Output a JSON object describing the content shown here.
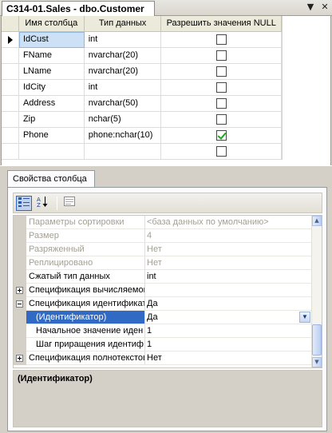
{
  "document_tab": {
    "title": "C314-01.Sales - dbo.Customer",
    "pin_icon": "▼",
    "close_icon": "✕"
  },
  "grid": {
    "headers": [
      "Имя столбца",
      "Тип данных",
      "Разрешить значения NULL"
    ],
    "rows": [
      {
        "name": "IdCust",
        "type": "int",
        "allow_null": false,
        "current": true
      },
      {
        "name": "FName",
        "type": "nvarchar(20)",
        "allow_null": false
      },
      {
        "name": "LName",
        "type": "nvarchar(20)",
        "allow_null": false
      },
      {
        "name": "IdCity",
        "type": "int",
        "allow_null": false
      },
      {
        "name": "Address",
        "type": "nvarchar(50)",
        "allow_null": false
      },
      {
        "name": "Zip",
        "type": "nchar(5)",
        "allow_null": false
      },
      {
        "name": "Phone",
        "type": "phone:nchar(10)",
        "allow_null": true
      },
      {
        "name": "",
        "type": "",
        "allow_null": false
      }
    ]
  },
  "properties": {
    "tab_label": "Свойства столбца",
    "toolbar": {
      "categorized_icon": "categorized-icon",
      "alphabetical_icon": "alphabetical-icon",
      "pages_icon": "property-pages-icon"
    },
    "rows": [
      {
        "name": "Параметры сортировки",
        "value": "<база данных по умолчанию>",
        "disabled": true
      },
      {
        "name": "Размер",
        "value": "4",
        "disabled": true
      },
      {
        "name": "Разряженный",
        "value": "Нет",
        "disabled": true
      },
      {
        "name": "Реплицировано",
        "value": "Нет",
        "disabled": true
      },
      {
        "name": "Сжатый тип данных",
        "value": "int"
      },
      {
        "name": "Спецификация вычисляемого",
        "value": "",
        "expander": "plus"
      },
      {
        "name": "Спецификация идентификат",
        "value": "Да",
        "expander": "minus"
      },
      {
        "name": "(Идентификатор)",
        "value": "Да",
        "child": true,
        "selected": true,
        "dropdown": true
      },
      {
        "name": "Начальное значение иден",
        "value": "1",
        "child": true
      },
      {
        "name": "Шаг приращения идентиф",
        "value": "1",
        "child": true
      },
      {
        "name": "Спецификация полнотекстов",
        "value": "Нет",
        "expander": "plus"
      }
    ],
    "description_title": "(Идентификатор)"
  },
  "colors": {
    "selection": "#316ac5",
    "check": "#21a121",
    "chrome": "#d4d0c8"
  }
}
